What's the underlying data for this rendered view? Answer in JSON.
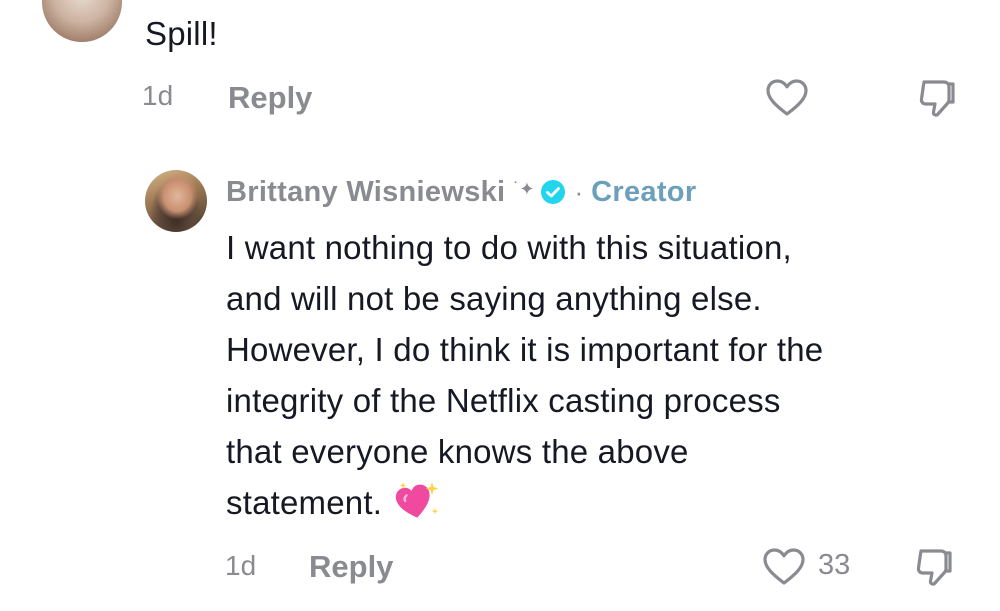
{
  "top_comment": {
    "text": "Spill!",
    "time": "1d",
    "reply_label": "Reply",
    "like_icon": "heart-outline-icon",
    "dislike_icon": "thumbs-down-icon"
  },
  "reply_comment": {
    "author": "Brittany Wisniewski",
    "author_badge_icon": "sparkle-icon",
    "verified_icon": "verified-check-icon",
    "separator": "·",
    "role": "Creator",
    "text_lines": [
      "I want nothing to do with this situation,",
      "and will not be saying anything else.",
      "However, I do think it is important for the",
      "integrity of the Netflix casting process",
      "that everyone knows the above",
      "statement."
    ],
    "emoji": "sparkling-heart-emoji",
    "time": "1d",
    "reply_label": "Reply",
    "like_count": "33",
    "like_icon": "heart-outline-icon",
    "dislike_icon": "thumbs-down-icon"
  },
  "colors": {
    "text": "#161823",
    "muted": "#8a8b91",
    "creator": "#6b9fba",
    "verified": "#20d5ec",
    "emoji_heart": "#f04aa0"
  }
}
